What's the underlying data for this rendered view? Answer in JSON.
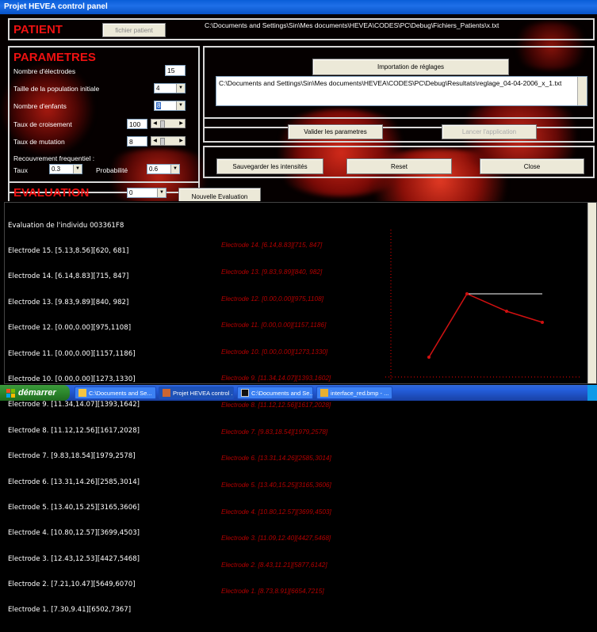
{
  "window": {
    "title": "Projet HEVEA control panel"
  },
  "patient": {
    "title": "PATIENT",
    "file_button": "fichier patient",
    "file_path": "C:\\Documents and Settings\\Sin\\Mes documents\\HEVEA\\CODES\\PC\\Debug\\Fichiers_Patients\\x.txt"
  },
  "parametres": {
    "title": "PARAMETRES",
    "electrodes_label": "Nombre d'électrodes",
    "electrodes_value": "15",
    "population_label": "Taille de la population initiale",
    "population_value": "4",
    "enfants_label": "Nombre d'enfants",
    "enfants_value": "8",
    "croisement_label": "Taux de croisement",
    "croisement_value": "100",
    "mutation_label": "Taux de mutation",
    "mutation_value": "8",
    "recouvrement_label": "Recouvrement frequentiel :",
    "taux_label": "Taux",
    "taux_value": "0.3",
    "probabilite_label": "Probabilité",
    "probabilite_value": "0.6"
  },
  "import": {
    "button": "Importation de réglages",
    "path": "C:\\Documents and Settings\\Sin\\Mes documents\\HEVEA\\CODES\\PC\\Debug\\Resultats\\reglage_04-04-2006_x_1.txt"
  },
  "actions": {
    "valider": "Valider les parametres",
    "lancer": "Lancer l'application",
    "sauvegarder": "Sauvegarder les intensités",
    "reset": "Reset",
    "close": "Close"
  },
  "evaluation": {
    "title": "EVALUATION",
    "combo_value": "0",
    "new_button": "Nouvelle Evaluation"
  },
  "log": {
    "lines": [
      "Evaluation de l'individu 003361F8",
      "Electrode 15. [5.13,8.56][620, 681]",
      "Electrode 14. [6.14,8.83][715, 847]",
      "Electrode 13. [9.83,9.89][840, 982]",
      "Electrode 12. [0.00,0.00][975,1108]",
      "Electrode 11. [0.00,0.00][1157,1186]",
      "Electrode 10. [0.00,0.00][1273,1330]",
      "Electrode 9. [11.34,14.07][1393,1642]",
      "Electrode 8. [11.12,12.56][1617,2028]",
      "Electrode 7. [9.83,18.54][1979,2578]",
      "Electrode 6. [13.31,14.26][2585,3014]",
      "Electrode 5. [13.40,15.25][3165,3606]",
      "Electrode 4. [10.80,12.57][3699,4503]",
      "Electrode 3. [12.43,12.53][4427,5468]",
      "Electrode 2. [7.21,10.47][5649,6070]",
      "Electrode 1. [7.30,9.41][6502,7367]"
    ],
    "red_lines": [
      "Electrode 14. [6.14,8.83][715, 847]",
      "Electrode 13. [9.83,9.89][840, 982]",
      "Electrode 12. [0.00,0.00][975,1108]",
      "Electrode 11. [0.00,0.00][1157,1186]",
      "Electrode 10. [0.00,0.00][1273,1330]",
      "Electrode 9. [11.34,14.07][1393,1602]",
      "Electrode 8. [11.12,12.56][1617,2028]",
      "Electrode 7. [9.83,18.54][1979,2578]",
      "Electrode 6. [13.31,14.26][2585,3014]",
      "Electrode 5. [13.40,15.25][3165,3606]",
      "Electrode 4. [10.80,12.57][3699,4503]",
      "Electrode 3. [11.09,12.40][4427,5468]",
      "Electrode 2. [8.43,11.21][5877,6142]",
      "Electrode 1. [8.73,8.91][6654,7215]"
    ]
  },
  "taskbar": {
    "start": "démarrer",
    "items": [
      "C:\\Documents and Se...",
      "Projet HEVEA control ...",
      "C:\\Documents and Se...",
      "interface_red.bmp - ..."
    ]
  },
  "colors": {
    "title_red": "#e11111",
    "graph_red": "#b00000",
    "xp_blue": "#245edb",
    "xp_green": "#2f8c2f"
  }
}
